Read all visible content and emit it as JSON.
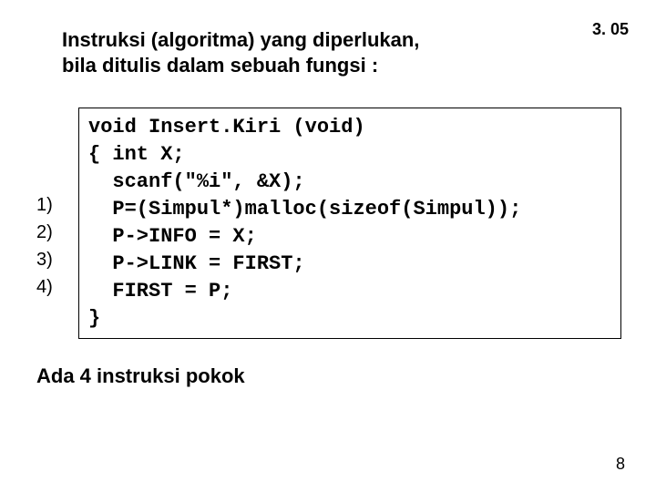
{
  "top_label": "3. 05",
  "intro_line1": "Instruksi (algoritma) yang diperlukan,",
  "intro_line2": "bila ditulis dalam sebuah fungsi :",
  "numbers": [
    "1)",
    "2)",
    "3)",
    "4)"
  ],
  "code_lines": [
    "void Insert.Kiri (void)",
    "{ int X;",
    "  scanf(\"%i\", &X);",
    "  P=(Simpul*)malloc(sizeof(Simpul));",
    "  P->INFO = X;",
    "  P->LINK = FIRST;",
    "  FIRST = P;",
    "}"
  ],
  "footer": "Ada 4 instruksi pokok",
  "page_number": "8"
}
